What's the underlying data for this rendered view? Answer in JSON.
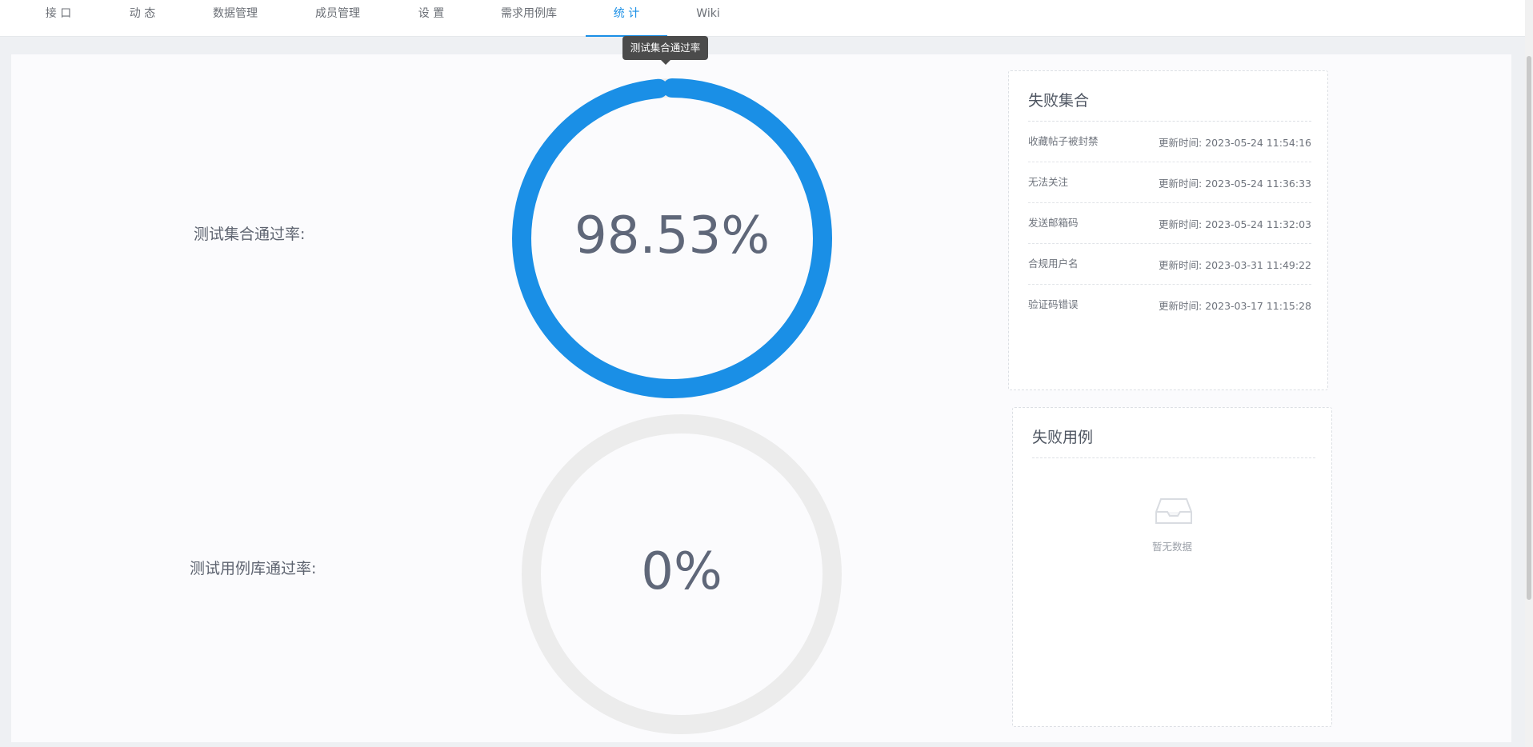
{
  "nav": {
    "tabs": [
      {
        "label": "接 口"
      },
      {
        "label": "动 态"
      },
      {
        "label": "数据管理"
      },
      {
        "label": "成员管理"
      },
      {
        "label": "设 置"
      },
      {
        "label": "需求用例库"
      },
      {
        "label": "统 计",
        "active": true
      },
      {
        "label": "Wiki"
      }
    ]
  },
  "tooltip": {
    "text": "测试集合通过率"
  },
  "stats": {
    "collection": {
      "label": "测试集合通过率:",
      "value_text": "98.53%",
      "percent": 98.53
    },
    "case_library": {
      "label": "测试用例库通过率:",
      "value_text": "0%",
      "percent": 0
    }
  },
  "failed_collections": {
    "title": "失败集合",
    "time_prefix": "更新时间:",
    "items": [
      {
        "name": "收藏帖子被封禁",
        "time": "2023-05-24 11:54:16"
      },
      {
        "name": "无法关注",
        "time": "2023-05-24 11:36:33"
      },
      {
        "name": "发送邮箱码",
        "time": "2023-05-24 11:32:03"
      },
      {
        "name": "合规用户名",
        "time": "2023-03-31 11:49:22"
      },
      {
        "name": "验证码错误",
        "time": "2023-03-17 11:15:28"
      }
    ]
  },
  "failed_cases": {
    "title": "失败用例",
    "empty_text": "暂无数据"
  },
  "colors": {
    "accent": "#1a8fe6",
    "gauge_track": "#ececec"
  }
}
